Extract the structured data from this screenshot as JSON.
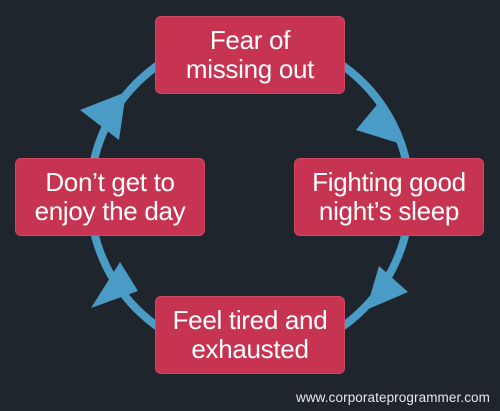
{
  "diagram": {
    "type": "cycle",
    "accent_color": "#4a9cc7",
    "node_color": "#c73451",
    "background_color": "#1f252c",
    "nodes": [
      {
        "id": "top",
        "label": "Fear of\nmissing out"
      },
      {
        "id": "right",
        "label": "Fighting good\nnight’s sleep"
      },
      {
        "id": "bottom",
        "label": "Feel tired and\nexhausted"
      },
      {
        "id": "left",
        "label": "Don’t get to\nenjoy the day"
      }
    ],
    "edges": [
      {
        "from": "top",
        "to": "right"
      },
      {
        "from": "right",
        "to": "bottom"
      },
      {
        "from": "bottom",
        "to": "left"
      },
      {
        "from": "left",
        "to": "top"
      }
    ],
    "direction": "clockwise"
  },
  "watermark": "www.corporateprogrammer.com"
}
